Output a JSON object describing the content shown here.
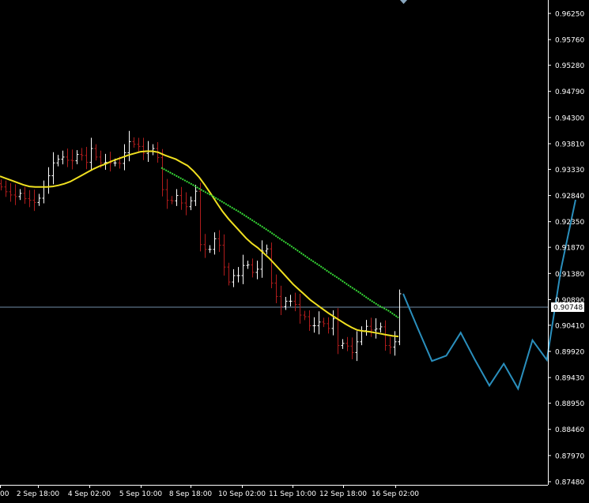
{
  "colors": {
    "background": "#000000",
    "axis": "#ffffff",
    "bull_candle": "#ffffff",
    "bear_candle": "#b01c1c",
    "ma_fast": "#f0e020",
    "ma_slow": "#36d836",
    "projection": "#2a8fbd",
    "price_line": "#6f8ea8",
    "price_box_bg": "#ffffff"
  },
  "current_price": {
    "label": "0.90748",
    "value": 0.90748
  },
  "marker_icon": "diamond-marker-icon",
  "chart_data": {
    "type": "line",
    "title": "",
    "xlabel": "",
    "ylabel": "",
    "ylim": [
      0.8728,
      0.9673
    ],
    "x_tick_labels": [
      "00",
      "2 Sep 18:00",
      "4 Sep 02:00",
      "5 Sep 10:00",
      "8 Sep 18:00",
      "10 Sep 02:00",
      "11 Sep 10:00",
      "12 Sep 18:00",
      "16 Sep 02:00"
    ],
    "y_tick_labels": [
      "0.96250",
      "0.95760",
      "0.95280",
      "0.94790",
      "0.94300",
      "0.93810",
      "0.93330",
      "0.92840",
      "0.92350",
      "0.91870",
      "0.91380",
      "0.90890",
      "0.90410",
      "0.89920",
      "0.89430",
      "0.88950",
      "0.88460",
      "0.87970",
      "0.87480"
    ],
    "y_ticks": [
      0.9625,
      0.9576,
      0.9528,
      0.9479,
      0.943,
      0.9381,
      0.9333,
      0.9284,
      0.9235,
      0.9187,
      0.9138,
      0.9089,
      0.9041,
      0.8992,
      0.8943,
      0.8895,
      0.8846,
      0.8797,
      0.8748
    ],
    "bar_count": 85,
    "bars_close": [
      0.93,
      0.9291,
      0.9285,
      0.9282,
      0.9288,
      0.9278,
      0.9275,
      0.9271,
      0.9279,
      0.93,
      0.9321,
      0.9345,
      0.9352,
      0.9356,
      0.935,
      0.9349,
      0.9361,
      0.9359,
      0.9346,
      0.9372,
      0.9356,
      0.9345,
      0.9346,
      0.9345,
      0.9345,
      0.9344,
      0.9364,
      0.9385,
      0.938,
      0.9376,
      0.9363,
      0.9366,
      0.9372,
      0.9355,
      0.9295,
      0.9275,
      0.9274,
      0.9284,
      0.927,
      0.9263,
      0.9274,
      0.9292,
      0.9192,
      0.9183,
      0.9183,
      0.9203,
      0.9191,
      0.915,
      0.9122,
      0.9134,
      0.9134,
      0.9153,
      0.9154,
      0.914,
      0.9146,
      0.918,
      0.9184,
      0.912,
      0.9095,
      0.9076,
      0.9086,
      0.9086,
      0.908,
      0.906,
      0.9057,
      0.904,
      0.904,
      0.9047,
      0.9044,
      0.9035,
      0.9053,
      0.9003,
      0.9007,
      0.9002,
      0.899,
      0.901,
      0.9031,
      0.9039,
      0.9032,
      0.9034,
      0.9038,
      0.9003,
      0.9,
      0.901,
      0.91
    ],
    "series": [
      {
        "name": "",
        "role": "ma_fast",
        "values": [
          0.932,
          0.9316,
          0.9312,
          0.9308,
          0.9304,
          0.9301,
          0.93,
          0.93,
          0.93,
          0.9301,
          0.9303,
          0.9306,
          0.931,
          0.9316,
          0.9322,
          0.9328,
          0.9334,
          0.9339,
          0.9343,
          0.9348,
          0.9352,
          0.9356,
          0.936,
          0.9363,
          0.9366,
          0.9367,
          0.9367,
          0.9365,
          0.936,
          0.9356,
          0.9352,
          0.9346,
          0.934,
          0.933,
          0.9318,
          0.9303,
          0.9287,
          0.927,
          0.9254,
          0.924,
          0.9228,
          0.9216,
          0.9204,
          0.9194,
          0.9186,
          0.9176,
          0.9166,
          0.9154,
          0.9142,
          0.913,
          0.9118,
          0.9108,
          0.9098,
          0.9088,
          0.908,
          0.9072,
          0.9064,
          0.9057,
          0.905,
          0.9043,
          0.9037,
          0.9032,
          0.903,
          0.9029,
          0.9027,
          0.9025,
          0.9023,
          0.9021,
          0.902
        ]
      },
      {
        "name": "",
        "role": "ma_slow",
        "values": [
          0.9336,
          0.9326,
          0.9316,
          0.9306,
          0.9295,
          0.9285,
          0.9274,
          0.9263,
          0.9252,
          0.924,
          0.9228,
          0.9216,
          0.9203,
          0.9191,
          0.9178,
          0.9165,
          0.9153,
          0.914,
          0.9128,
          0.9115,
          0.9103,
          0.909,
          0.9078,
          0.9068,
          0.9055
        ]
      }
    ],
    "projection": {
      "name": "",
      "values": [
        0.91,
        0.9036,
        0.8974,
        0.8984,
        0.9027,
        0.8976,
        0.8928,
        0.8969,
        0.8922,
        0.9013,
        0.8976,
        0.9148,
        0.9276
      ]
    }
  }
}
